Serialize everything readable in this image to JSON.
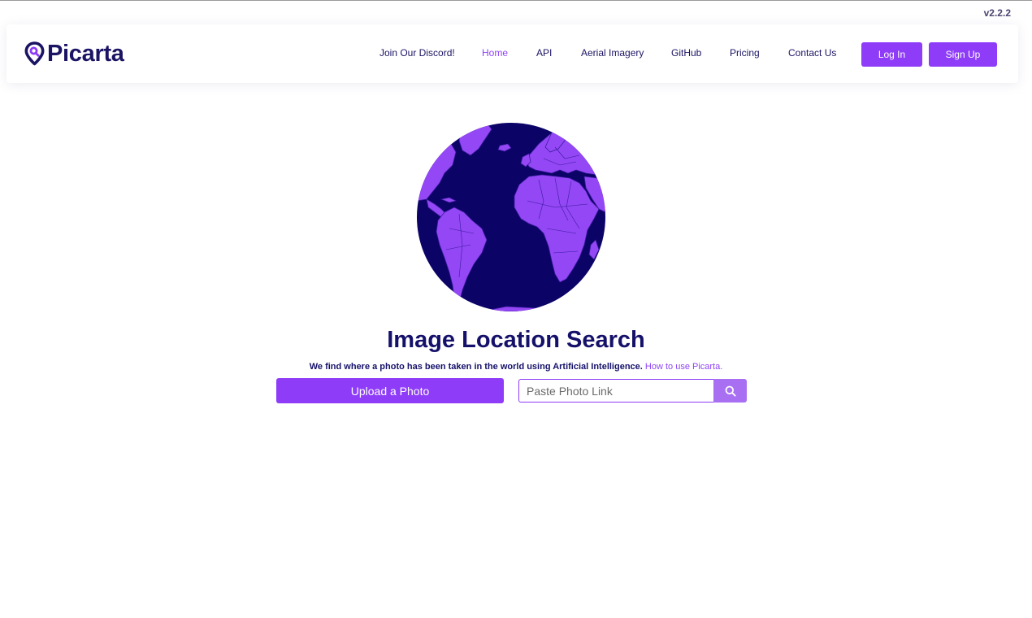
{
  "version": "v2.2.2",
  "brand": {
    "name": "Picarta",
    "logo_icon": "map-pin-logo-icon",
    "color": "#1b1464"
  },
  "nav": {
    "links": [
      {
        "label": "Join Our Discord!",
        "active": false
      },
      {
        "label": "Home",
        "active": true
      },
      {
        "label": "API",
        "active": false
      },
      {
        "label": "Aerial Imagery",
        "active": false
      },
      {
        "label": "GitHub",
        "active": false
      },
      {
        "label": "Pricing",
        "active": false
      },
      {
        "label": "Contact Us",
        "active": false
      }
    ],
    "login_label": "Log In",
    "signup_label": "Sign Up"
  },
  "hero": {
    "globe_icon": "globe-icon",
    "title": "Image Location Search",
    "subtitle": "We find where a photo has been taken in the world using Artificial Intelligence.",
    "help_link": "How to use Picarta.",
    "upload_label": "Upload a Photo",
    "link_placeholder": "Paste Photo Link",
    "search_icon": "search-icon"
  },
  "colors": {
    "accent": "#8e3cf7",
    "accent_light": "#a86ff3",
    "ocean": "#0b0366",
    "land": "#9447f5",
    "text_dark": "#15116a"
  }
}
